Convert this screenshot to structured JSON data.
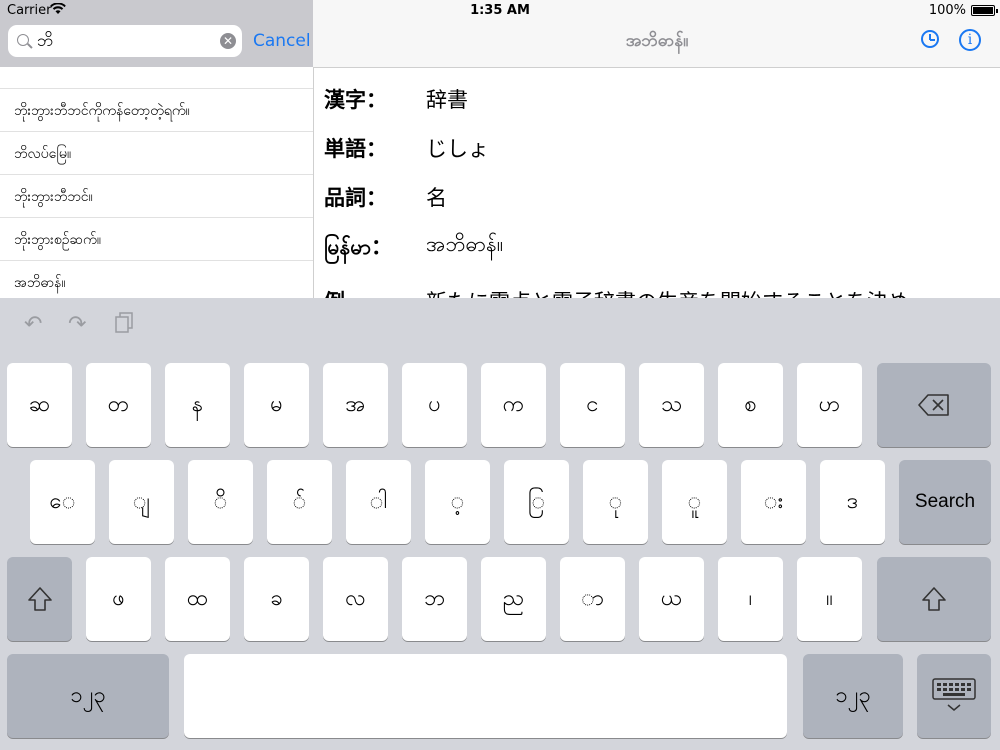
{
  "status_bar": {
    "carrier": "Carrier",
    "time": "1:35 AM",
    "battery": "100%"
  },
  "search": {
    "query": "ဘိ",
    "cancel_label": "Cancel"
  },
  "results": [
    "ဘိုးဘွားဘီဘင်ကိုကန်တော့တဲ့ရက်။",
    "ဘိလပ်မြေ။",
    "ဘိုးဘွားဘီဘင်။",
    "ဘိုးဘွားစဉ်ဆက်။",
    "အဘိဓာန်။"
  ],
  "detail": {
    "nav_title": "အဘိဓာန်။",
    "rows": [
      {
        "label": "漢字：",
        "value": "辞書"
      },
      {
        "label": "単語：",
        "value": "じしょ"
      },
      {
        "label": "品詞：",
        "value": "名"
      },
      {
        "label": "မြန်မာ：",
        "value": "အဘိဓာန်။"
      },
      {
        "label": "例",
        "value": "新たに電点と電子辞書の生産を開始することを決め"
      }
    ]
  },
  "toolbar": {
    "icons": [
      "undo-icon",
      "redo-icon",
      "paste-icon"
    ]
  },
  "keyboard": {
    "row1": [
      "ဆ",
      "တ",
      "န",
      "မ",
      "အ",
      "ပ",
      "က",
      "င",
      "သ",
      "စ",
      "ဟ"
    ],
    "row2": [
      "ေ",
      "ျ",
      "ိ",
      "်",
      "ါ",
      "့",
      "ြ",
      "ု",
      "ူ",
      "း",
      "ဒ"
    ],
    "search_label": "Search",
    "row3": [
      "ဖ",
      "ထ",
      "ခ",
      "လ",
      "ဘ",
      "ည",
      "ာ",
      "ယ",
      "၊",
      "။"
    ],
    "numbers_label": "၁၂၃"
  },
  "colors": {
    "accent": "#1a78f2",
    "key_bg": "#ffffff",
    "func_key_bg": "#aeb3bd",
    "keyboard_bg": "#d3d5db"
  }
}
